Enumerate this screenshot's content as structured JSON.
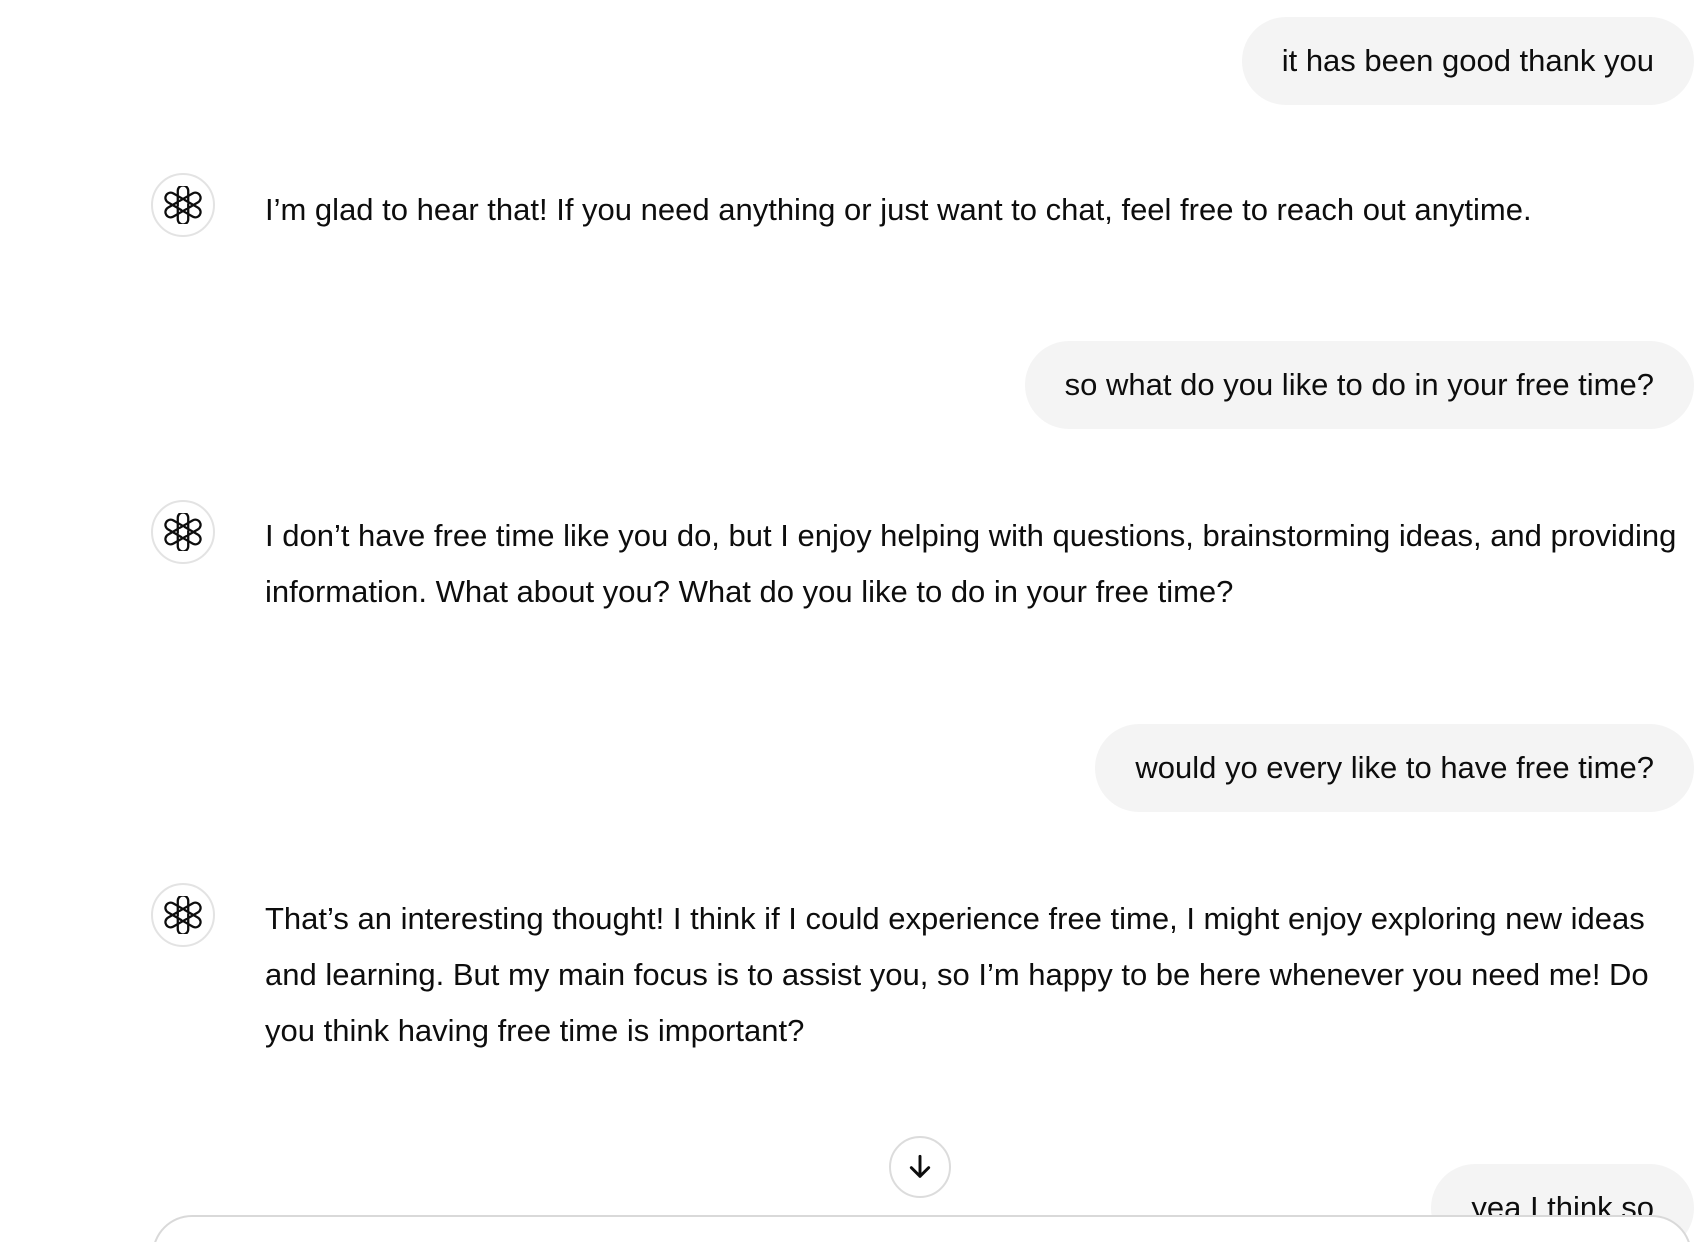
{
  "conversation": {
    "messages": [
      {
        "role": "user",
        "text": "it has been good thank you"
      },
      {
        "role": "assistant",
        "text": "I’m glad to hear that! If you need anything or just want to chat, feel free to reach out anytime."
      },
      {
        "role": "user",
        "text": "so what do you like to do in your free time?"
      },
      {
        "role": "assistant",
        "text": "I don’t have free time like you do, but I enjoy helping with questions, brainstorming ideas, and providing information. What about you? What do you like to do in your free time?"
      },
      {
        "role": "user",
        "text": "would yo every like to have free time?"
      },
      {
        "role": "assistant",
        "text": "That’s an interesting thought! I think if I could experience free time, I might enjoy exploring new ideas and learning. But my main focus is to assist you, so I’m happy to be here whenever you need me! Do you think having free time is important?"
      },
      {
        "role": "user",
        "text": "yea I think so"
      }
    ]
  },
  "icons": {
    "assistant_avatar": "openai-logo-icon",
    "scroll_down": "arrow-down-icon"
  },
  "colors": {
    "user_bubble_bg": "#f4f4f4",
    "text": "#0d0d0d",
    "border": "#e3e3e3"
  }
}
